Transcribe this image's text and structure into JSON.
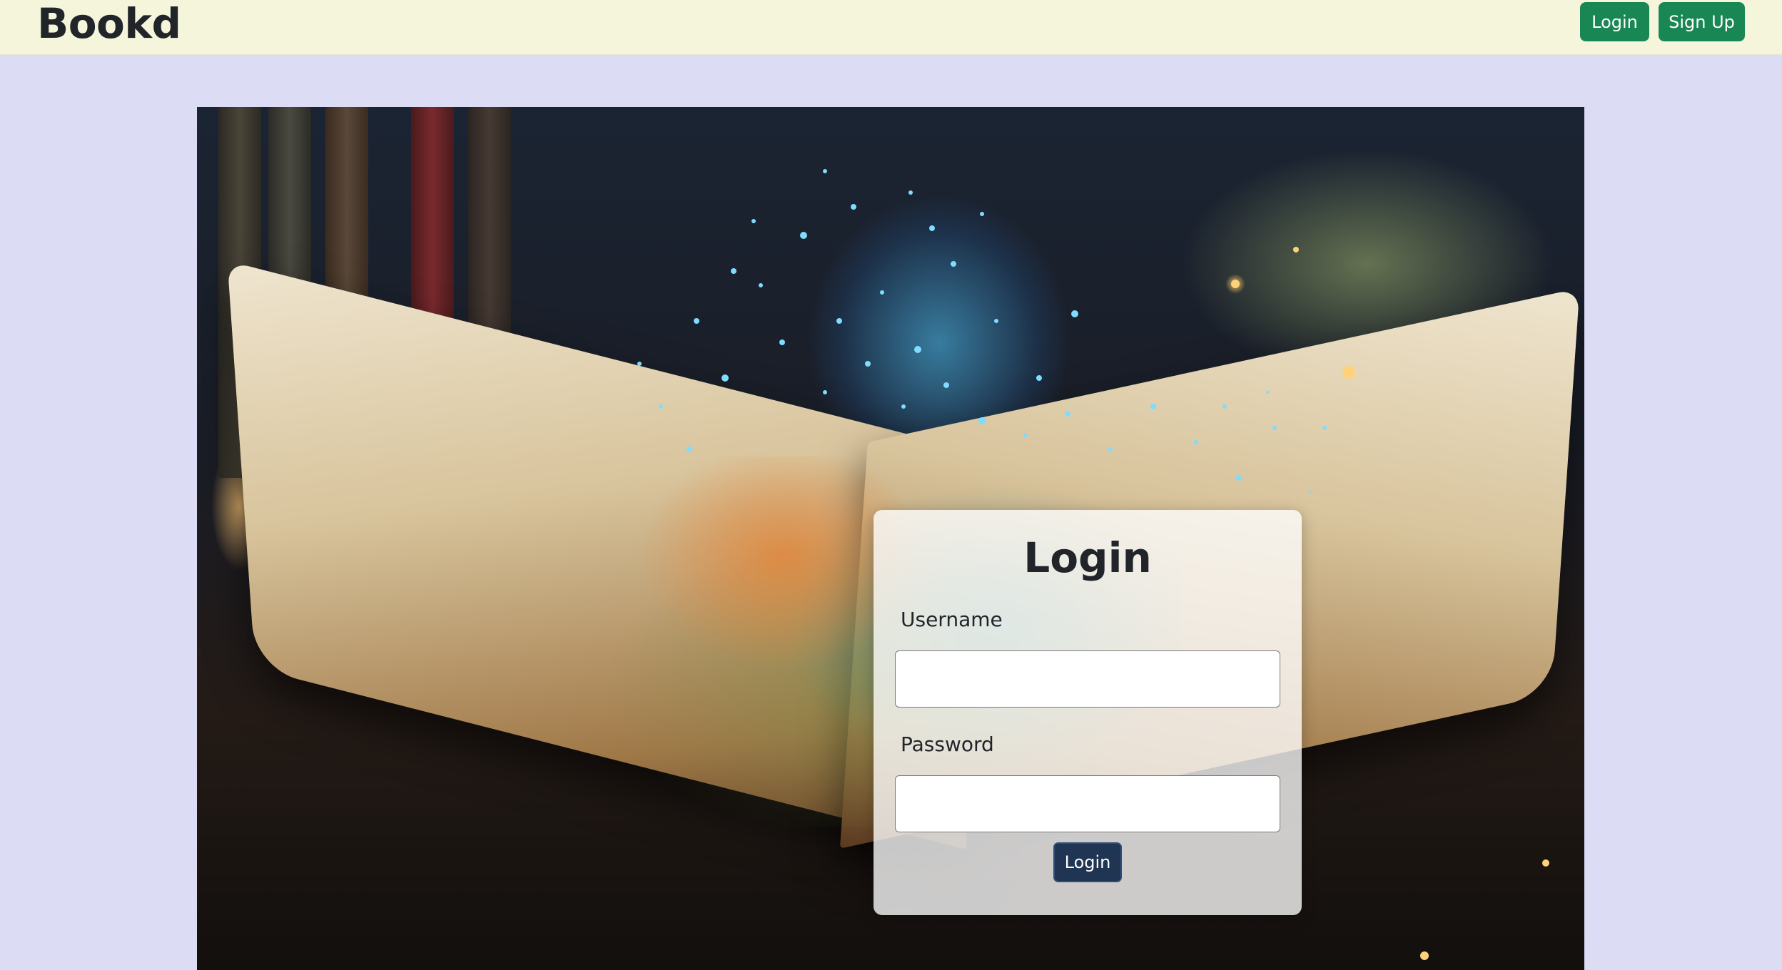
{
  "navbar": {
    "brand": "Bookd",
    "login_label": "Login",
    "signup_label": "Sign Up"
  },
  "login_form": {
    "title": "Login",
    "username_label": "Username",
    "username_value": "",
    "password_label": "Password",
    "password_value": "",
    "submit_label": "Login"
  },
  "colors": {
    "navbar_bg": "#f5f5dc",
    "page_bg": "#dcdcf4",
    "nav_button": "#198754",
    "submit_button": "#1f3553"
  }
}
